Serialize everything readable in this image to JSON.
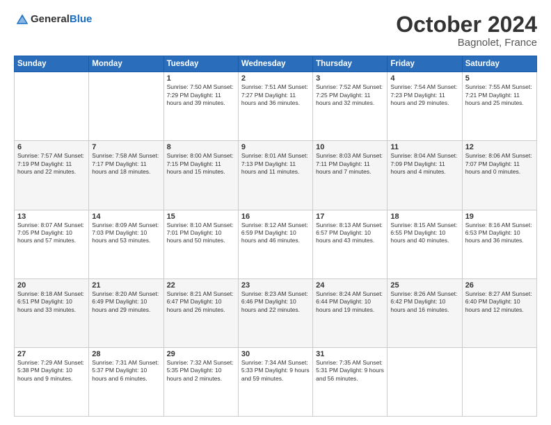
{
  "header": {
    "logo_general": "General",
    "logo_blue": "Blue",
    "month": "October 2024",
    "location": "Bagnolet, France"
  },
  "weekdays": [
    "Sunday",
    "Monday",
    "Tuesday",
    "Wednesday",
    "Thursday",
    "Friday",
    "Saturday"
  ],
  "weeks": [
    [
      {
        "day": "",
        "content": ""
      },
      {
        "day": "",
        "content": ""
      },
      {
        "day": "1",
        "content": "Sunrise: 7:50 AM\nSunset: 7:29 PM\nDaylight: 11 hours and 39 minutes."
      },
      {
        "day": "2",
        "content": "Sunrise: 7:51 AM\nSunset: 7:27 PM\nDaylight: 11 hours and 36 minutes."
      },
      {
        "day": "3",
        "content": "Sunrise: 7:52 AM\nSunset: 7:25 PM\nDaylight: 11 hours and 32 minutes."
      },
      {
        "day": "4",
        "content": "Sunrise: 7:54 AM\nSunset: 7:23 PM\nDaylight: 11 hours and 29 minutes."
      },
      {
        "day": "5",
        "content": "Sunrise: 7:55 AM\nSunset: 7:21 PM\nDaylight: 11 hours and 25 minutes."
      }
    ],
    [
      {
        "day": "6",
        "content": "Sunrise: 7:57 AM\nSunset: 7:19 PM\nDaylight: 11 hours and 22 minutes."
      },
      {
        "day": "7",
        "content": "Sunrise: 7:58 AM\nSunset: 7:17 PM\nDaylight: 11 hours and 18 minutes."
      },
      {
        "day": "8",
        "content": "Sunrise: 8:00 AM\nSunset: 7:15 PM\nDaylight: 11 hours and 15 minutes."
      },
      {
        "day": "9",
        "content": "Sunrise: 8:01 AM\nSunset: 7:13 PM\nDaylight: 11 hours and 11 minutes."
      },
      {
        "day": "10",
        "content": "Sunrise: 8:03 AM\nSunset: 7:11 PM\nDaylight: 11 hours and 7 minutes."
      },
      {
        "day": "11",
        "content": "Sunrise: 8:04 AM\nSunset: 7:09 PM\nDaylight: 11 hours and 4 minutes."
      },
      {
        "day": "12",
        "content": "Sunrise: 8:06 AM\nSunset: 7:07 PM\nDaylight: 11 hours and 0 minutes."
      }
    ],
    [
      {
        "day": "13",
        "content": "Sunrise: 8:07 AM\nSunset: 7:05 PM\nDaylight: 10 hours and 57 minutes."
      },
      {
        "day": "14",
        "content": "Sunrise: 8:09 AM\nSunset: 7:03 PM\nDaylight: 10 hours and 53 minutes."
      },
      {
        "day": "15",
        "content": "Sunrise: 8:10 AM\nSunset: 7:01 PM\nDaylight: 10 hours and 50 minutes."
      },
      {
        "day": "16",
        "content": "Sunrise: 8:12 AM\nSunset: 6:59 PM\nDaylight: 10 hours and 46 minutes."
      },
      {
        "day": "17",
        "content": "Sunrise: 8:13 AM\nSunset: 6:57 PM\nDaylight: 10 hours and 43 minutes."
      },
      {
        "day": "18",
        "content": "Sunrise: 8:15 AM\nSunset: 6:55 PM\nDaylight: 10 hours and 40 minutes."
      },
      {
        "day": "19",
        "content": "Sunrise: 8:16 AM\nSunset: 6:53 PM\nDaylight: 10 hours and 36 minutes."
      }
    ],
    [
      {
        "day": "20",
        "content": "Sunrise: 8:18 AM\nSunset: 6:51 PM\nDaylight: 10 hours and 33 minutes."
      },
      {
        "day": "21",
        "content": "Sunrise: 8:20 AM\nSunset: 6:49 PM\nDaylight: 10 hours and 29 minutes."
      },
      {
        "day": "22",
        "content": "Sunrise: 8:21 AM\nSunset: 6:47 PM\nDaylight: 10 hours and 26 minutes."
      },
      {
        "day": "23",
        "content": "Sunrise: 8:23 AM\nSunset: 6:46 PM\nDaylight: 10 hours and 22 minutes."
      },
      {
        "day": "24",
        "content": "Sunrise: 8:24 AM\nSunset: 6:44 PM\nDaylight: 10 hours and 19 minutes."
      },
      {
        "day": "25",
        "content": "Sunrise: 8:26 AM\nSunset: 6:42 PM\nDaylight: 10 hours and 16 minutes."
      },
      {
        "day": "26",
        "content": "Sunrise: 8:27 AM\nSunset: 6:40 PM\nDaylight: 10 hours and 12 minutes."
      }
    ],
    [
      {
        "day": "27",
        "content": "Sunrise: 7:29 AM\nSunset: 5:38 PM\nDaylight: 10 hours and 9 minutes."
      },
      {
        "day": "28",
        "content": "Sunrise: 7:31 AM\nSunset: 5:37 PM\nDaylight: 10 hours and 6 minutes."
      },
      {
        "day": "29",
        "content": "Sunrise: 7:32 AM\nSunset: 5:35 PM\nDaylight: 10 hours and 2 minutes."
      },
      {
        "day": "30",
        "content": "Sunrise: 7:34 AM\nSunset: 5:33 PM\nDaylight: 9 hours and 59 minutes."
      },
      {
        "day": "31",
        "content": "Sunrise: 7:35 AM\nSunset: 5:31 PM\nDaylight: 9 hours and 56 minutes."
      },
      {
        "day": "",
        "content": ""
      },
      {
        "day": "",
        "content": ""
      }
    ]
  ]
}
